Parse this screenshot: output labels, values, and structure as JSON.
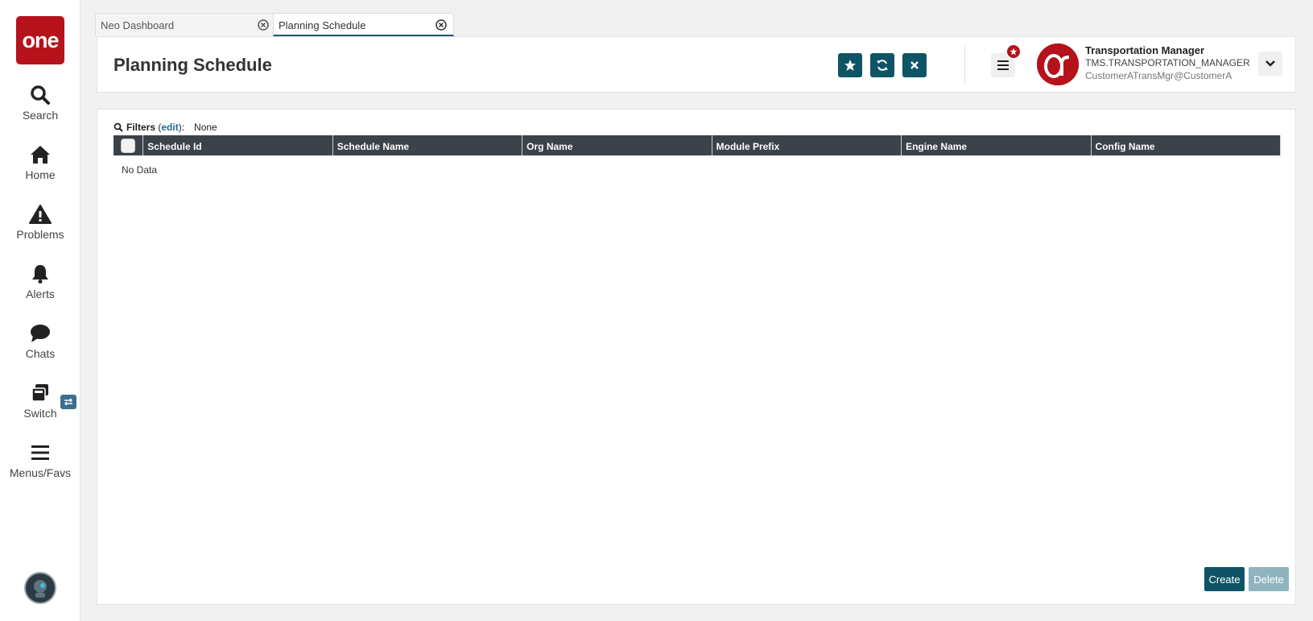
{
  "app": {
    "logo_text": "one"
  },
  "sidebar": {
    "items": [
      {
        "label": "Search",
        "icon": "search-icon"
      },
      {
        "label": "Home",
        "icon": "home-icon"
      },
      {
        "label": "Problems",
        "icon": "warning-icon"
      },
      {
        "label": "Alerts",
        "icon": "bell-icon"
      },
      {
        "label": "Chats",
        "icon": "chat-icon"
      },
      {
        "label": "Switch",
        "icon": "switch-icon"
      },
      {
        "label": "Menus/Favs",
        "icon": "hamburger-icon"
      }
    ]
  },
  "tabs": [
    {
      "label": "Neo Dashboard",
      "active": false
    },
    {
      "label": "Planning Schedule",
      "active": true
    }
  ],
  "header": {
    "title": "Planning Schedule",
    "user": {
      "name": "Transportation Manager",
      "role": "TMS.TRANSPORTATION_MANAGER",
      "email": "CustomerATransMgr@CustomerA"
    }
  },
  "filters": {
    "label": "Filters",
    "edit_label": "edit",
    "value": "None"
  },
  "grid": {
    "columns": [
      "Schedule Id",
      "Schedule Name",
      "Org Name",
      "Module Prefix",
      "Engine Name",
      "Config Name"
    ],
    "rows": [],
    "empty_text": "No Data"
  },
  "actions": {
    "create_label": "Create",
    "delete_label": "Delete"
  },
  "colors": {
    "brand": "#b5121b",
    "primary": "#0f5466",
    "grid_header": "#3b4249"
  }
}
